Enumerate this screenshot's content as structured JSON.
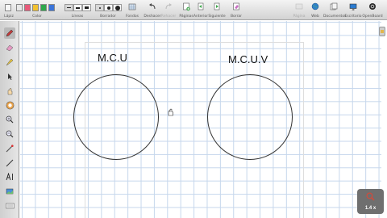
{
  "toolbar": {
    "groups": {
      "lapiz": "Lápiz",
      "color": "Color",
      "lineas": "Líneas",
      "borrador": "Borrador"
    },
    "buttons": {
      "fondos": "Fondos",
      "deshacer": "Deshacer",
      "rehacer": "Rehacer",
      "paginas": "Páginas",
      "anterior": "Anterior",
      "siguiente": "Siguiente",
      "borrar": "Borrar",
      "pagina": "Página",
      "web": "Web",
      "documentos": "Documentos",
      "escritorio": "Escritorio",
      "openboard": "OpenBoard"
    },
    "swatches": [
      "#e8e8e8",
      "#e85a7a",
      "#f2c230",
      "#2ea84c",
      "#3a74d9"
    ]
  },
  "board": {
    "labels": {
      "left": "M.C.U",
      "right": "M.C.U.V"
    }
  },
  "zoom": {
    "label": "1.4 x"
  }
}
